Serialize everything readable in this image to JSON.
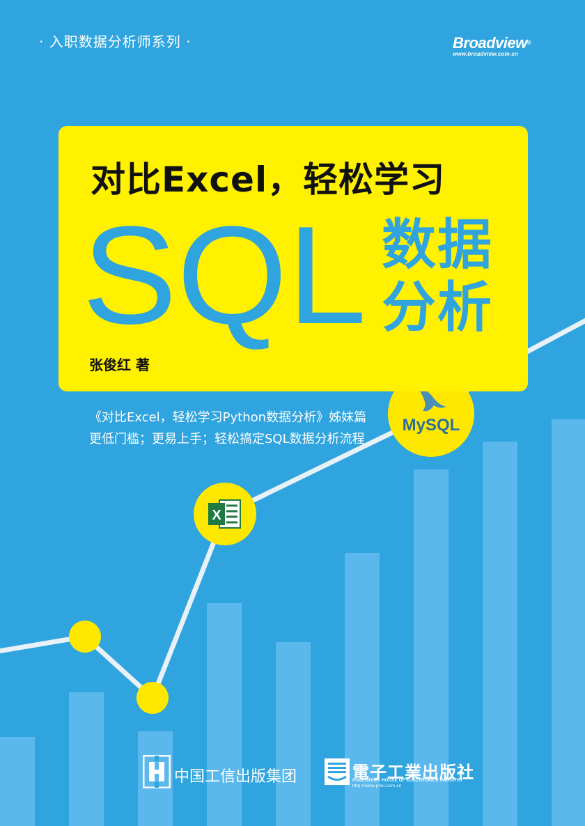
{
  "series_line": "· 入职数据分析师系列 ·",
  "brand": {
    "name": "Broadview",
    "reg": "®",
    "url": "www.broadview.com.cn"
  },
  "title": {
    "headline": "对比Excel，轻松学习",
    "main": "SQL",
    "side_line1": "数据",
    "side_line2": "分析"
  },
  "author": "张俊红  著",
  "taglines": [
    "《对比Excel，轻松学习Python数据分析》姊妹篇",
    "更低门槛；更易上手；轻松搞定SQL数据分析流程"
  ],
  "badges": {
    "mysql_logo_text": "MySQL",
    "excel_icon": "excel-icon"
  },
  "publishers": {
    "pub1_name": "中国工信出版集团",
    "pub2_name": "電子工業出版社",
    "pub2_en": "PUBLISHING HOUSE OF ELECTRONICS INDUSTRY",
    "pub2_url": "http://www.phei.com.cn"
  },
  "colors": {
    "background": "#2fa4de",
    "panel": "#fff100",
    "bar": "#5ab8ec",
    "accent_yellow": "#ffe800",
    "line": "#e8f1f7"
  },
  "chart_data": {
    "type": "bar",
    "categories": [],
    "values": [
      16,
      24,
      17,
      40,
      33,
      49,
      64,
      69,
      73
    ],
    "line_values": [
      31,
      34,
      23,
      56,
      74,
      84,
      92
    ],
    "ylim": [
      0,
      100
    ]
  }
}
